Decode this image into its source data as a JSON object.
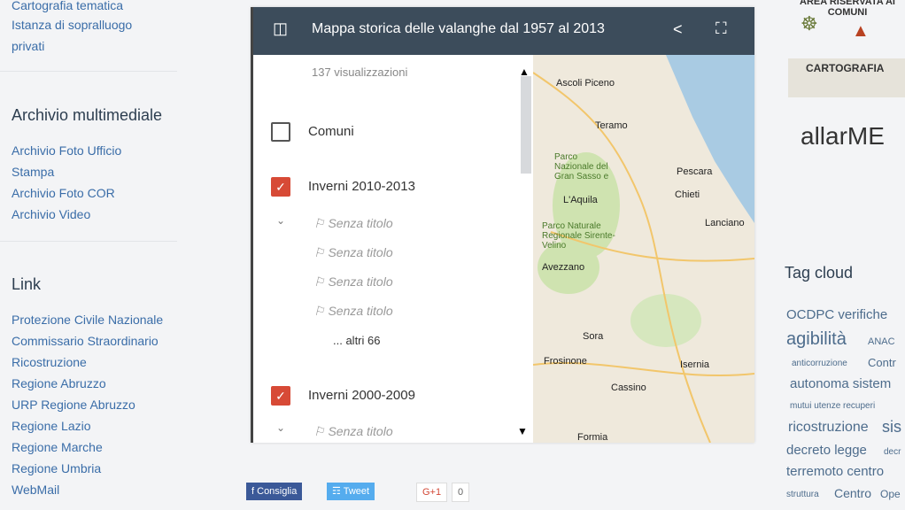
{
  "sidebar": {
    "top_links": [
      "Cartografia tematica",
      "Istanza di sopralluogo",
      "privati"
    ],
    "archivio_title": "Archivio multimediale",
    "archivio_links": [
      "Archivio Foto Ufficio",
      "Stampa",
      "Archivio Foto COR",
      "Archivio Video"
    ],
    "link_title": "Link",
    "links": [
      "Protezione Civile Nazionale",
      "Commissario Straordinario",
      "Ricostruzione",
      "Regione Abruzzo",
      "URP Regione Abruzzo",
      "Regione Lazio",
      "Regione Marche",
      "Regione Umbria",
      "WebMail"
    ]
  },
  "map_widget": {
    "title": "Mappa storica delle valanghe dal 1957 al 2013",
    "views": "137 visualizzazioni",
    "layers": [
      {
        "label": "Comuni",
        "checked": false
      },
      {
        "label": "Inverni 2010-2013",
        "checked": true
      },
      {
        "label": "Inverni 2000-2009",
        "checked": true
      }
    ],
    "untitled": "Senza titolo",
    "more": "... altri 66",
    "places": [
      "Ascoli Piceno",
      "Teramo",
      "Parco Nazionale del Gran Sasso e",
      "L'Aquila",
      "Pescara",
      "Chieti",
      "Parco Naturale Regionale Sirente-Velino",
      "Lanciano",
      "Avezzano",
      "Sora",
      "Frosinone",
      "Isernia",
      "Cassino",
      "Formia"
    ]
  },
  "right": {
    "area_riservata": "AREA RISERVATA AI COMUNI",
    "cartografia": "CARTOGRAFIA",
    "allarme": "allarME",
    "tag_title": "Tag cloud",
    "tags": [
      "OCDPC verifiche",
      "agibilità",
      "ANAC",
      "anticorruzione",
      "Contr",
      "autonoma sistem",
      "mutui utenze recuperi",
      "ricostruzione",
      "sis",
      "decreto legge",
      "decr",
      "terremoto centro",
      "struttura",
      "Centro",
      "Ope"
    ]
  },
  "social": {
    "fb": "Consiglia",
    "tw": "Tweet",
    "gplus": "G+1",
    "gcount": "0"
  },
  "colors": {
    "widget_bar": "#3c4c5b",
    "checkbox_on": "#d74a36",
    "link": "#3a6da8"
  }
}
